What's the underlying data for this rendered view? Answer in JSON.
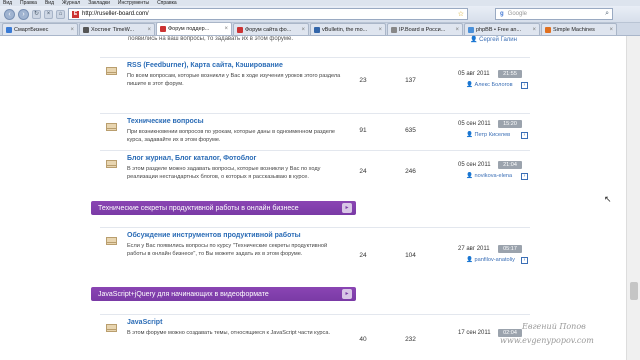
{
  "browser": {
    "menu": [
      "Вид",
      "Правка",
      "Вид",
      "Журнал",
      "Закладки",
      "Инструменты",
      "Справка"
    ],
    "url": "http://ruseller-board.com/",
    "search_placeholder": "Google",
    "search_engine": "g",
    "tabs": [
      {
        "label": "СмартБизнес",
        "icon_color": "#3a7bd5",
        "active": false
      },
      {
        "label": "Хостинг TimeW...",
        "icon_color": "#555555",
        "active": false
      },
      {
        "label": "Форум поддер...",
        "icon_color": "#cc3333",
        "active": true
      },
      {
        "label": "Форум сайта фо...",
        "icon_color": "#cc3333",
        "active": false
      },
      {
        "label": "vBulletin, the mo...",
        "icon_color": "#3366aa",
        "active": false
      },
      {
        "label": "IP.Board в Росси...",
        "icon_color": "#888888",
        "active": false
      },
      {
        "label": "phpBB • Free an...",
        "icon_color": "#4a90d9",
        "active": false
      },
      {
        "label": "Simple Machines",
        "icon_color": "#e07020",
        "active": false
      }
    ]
  },
  "top_partial": {
    "desc": "появились на ваш вопросы, то задавать их в этом форуме.",
    "user": "Сергей Галин"
  },
  "forums": [
    {
      "title": "RSS (Feedburner), Карта сайта, Кэширование",
      "desc": "По всем вопросам, которые возникли у Вас в ходе изучения уроков этого раздела пишите в этот форум.",
      "threads": "23",
      "posts": "137",
      "date": "05 авг 2011",
      "time": "21:55",
      "user": "Алекс Бологов"
    },
    {
      "title": "Технические вопросы",
      "desc": "При возникновении вопросов по урокам, которые даны в одноименном разделе курса, задавайте их в этом форуме.",
      "threads": "91",
      "posts": "635",
      "date": "05 сен 2011",
      "time": "15:20",
      "user": "Петр Киселев"
    },
    {
      "title": "Блог журнал, Блог каталог, Фотоблог",
      "desc": "В этом разделе можно задавать вопросы, которые возникли у Вас по ходу реализации нестандартных блогов, о которых я рассказываю в курсе.",
      "threads": "24",
      "posts": "246",
      "date": "05 сен 2011",
      "time": "21:04",
      "user": "novikova-elena"
    },
    {
      "title": "Обсуждение инструментов продуктивной работы",
      "desc": "Если у Вас появились вопросы по курсу \"Технические секреты продуктивной работы в онлайн бизнесе\", то Вы можете задать их в этом форуме.",
      "threads": "24",
      "posts": "104",
      "date": "27 авг 2011",
      "time": "05:17",
      "user": "panfilov-anatoliy"
    },
    {
      "title": "JavaScript",
      "desc": "В этом форуме можно создавать темы, относящиеся к JavaScript части курса.",
      "threads": "40",
      "posts": "232",
      "date": "17 сен 2011",
      "time": "02:04",
      "user": ""
    }
  ],
  "categories": [
    {
      "title": "Технические секреты продуктивной работы в онлайн бизнесе",
      "button": "▸"
    },
    {
      "title": "JavaScript+jQuery для начинающих в видеоформате",
      "button": "▸"
    }
  ],
  "watermark": {
    "name": "Евгений Попов",
    "url": "www.evgenypopov.com"
  }
}
